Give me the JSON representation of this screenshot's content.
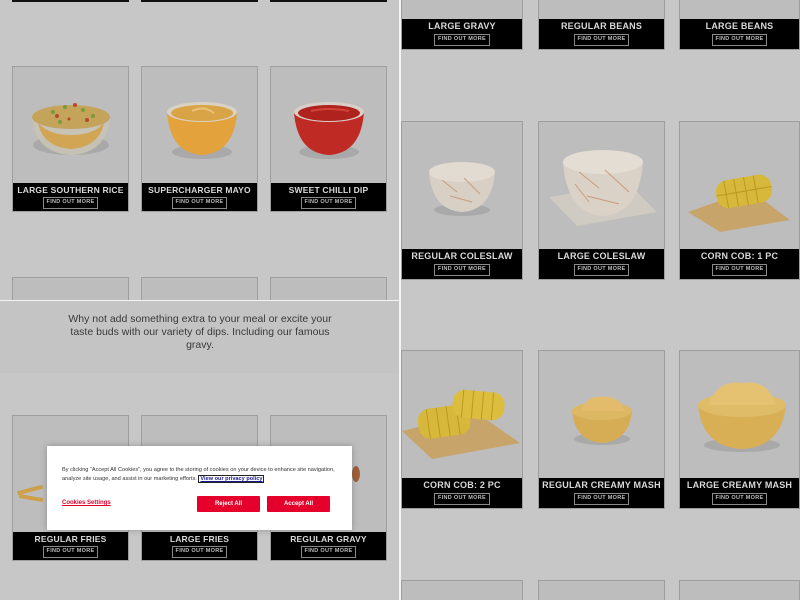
{
  "intro_text": "Why not add something extra to your meal or excite your taste buds with our variety of dips. Including our famous gravy.",
  "cta_label": "FIND OUT MORE",
  "top_left_products": [
    "LARGE SOUTHERN RICE",
    "SUPERCHARGER MAYO",
    "SWEET CHILLI DIP"
  ],
  "bottom_left_products": [
    "REGULAR FRIES",
    "LARGE FRIES",
    "REGULAR GRAVY"
  ],
  "right_products": {
    "row1": [
      "LARGE GRAVY",
      "REGULAR BEANS",
      "LARGE BEANS"
    ],
    "row2": [
      "REGULAR COLESLAW",
      "LARGE COLESLAW",
      "CORN COB: 1 PC"
    ],
    "row3": [
      "CORN COB: 2 PC",
      "REGULAR CREAMY MASH",
      "LARGE CREAMY MASH"
    ]
  },
  "cookie_banner": {
    "text": "By clicking “Accept All Cookies”, you agree to the storing of cookies on your device to enhance site navigation, analyze site usage, and assist in our marketing efforts.",
    "policy_link": "View our privacy policy",
    "settings_label": "Cookies Settings",
    "reject_label": "Reject All",
    "accept_label": "Accept All"
  },
  "colors": {
    "overlay_bg": "#c7c7c7",
    "card_bar": "#000000",
    "accent_red": "#e4002b"
  }
}
